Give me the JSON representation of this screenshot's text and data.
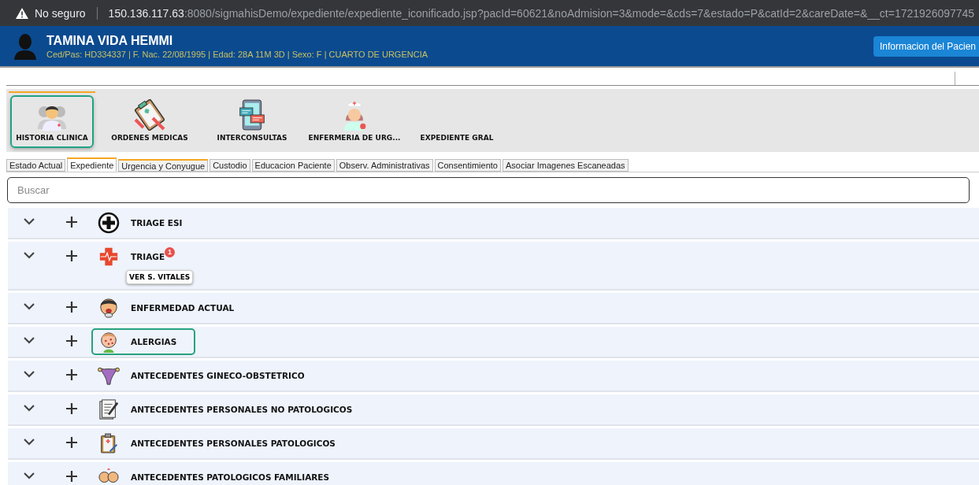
{
  "browser": {
    "security": "No seguro",
    "url_host": "150.136.117.63",
    "url_rest": ":8080/sigmahisDemo/expediente/expediente_iconificado.jsp?pacId=60621&noAdmision=3&mode=&cds=7&estado=P&catId=2&careDate=&__ct=1721926097745"
  },
  "patient": {
    "name": "TAMINA VIDA HEMMI",
    "details": "Ced/Pas: HD334337 | F. Nac. 22/08/1995 | Edad: 28A 11M 3D | Sexo: F  | CUARTO DE URGENCIA",
    "info_button": "Informacion del Pacien"
  },
  "modules": [
    {
      "label": "HISTORIA CLINICA",
      "kind": "doctor",
      "selected": true
    },
    {
      "label": "ORDENES MEDICAS",
      "kind": "clipboard",
      "selected": false
    },
    {
      "label": "INTERCONSULTAS",
      "kind": "chat",
      "selected": false
    },
    {
      "label": "ENFERMERIA DE URG...",
      "kind": "nurse",
      "selected": false
    },
    {
      "label": "EXPEDIENTE GRAL",
      "kind": "none",
      "selected": false
    }
  ],
  "tabs": [
    {
      "label": "Estado Actual",
      "selected": false,
      "flagged": false
    },
    {
      "label": "Expediente",
      "selected": true,
      "flagged": true
    },
    {
      "label": "Urgencia y Conyugue",
      "selected": false,
      "flagged": true
    },
    {
      "label": "Custodio",
      "selected": false,
      "flagged": false
    },
    {
      "label": "Educacion Paciente",
      "selected": false,
      "flagged": false
    },
    {
      "label": "Observ. Administrativas",
      "selected": false,
      "flagged": false
    },
    {
      "label": "Consentimiento",
      "selected": false,
      "flagged": false
    },
    {
      "label": "Asociar Imagenes Escaneadas",
      "selected": false,
      "flagged": false
    }
  ],
  "search": {
    "placeholder": "Buscar"
  },
  "sections": [
    {
      "title": "TRIAGE ESI",
      "kind": "circle-plus",
      "selected": false
    },
    {
      "title": "TRIAGE",
      "kind": "red-cross",
      "selected": false,
      "badge": "1",
      "button": "VER S. VITALES"
    },
    {
      "title": "ENFERMEDAD ACTUAL",
      "kind": "face",
      "selected": false
    },
    {
      "title": "ALERGIAS",
      "kind": "rash-face",
      "selected": true
    },
    {
      "title": "ANTECEDENTES GINECO-OBSTETRICO",
      "kind": "uterus",
      "selected": false
    },
    {
      "title": "ANTECEDENTES PERSONALES NO PATOLOGICOS",
      "kind": "notes",
      "selected": false
    },
    {
      "title": "ANTECEDENTES PERSONALES PATOLOGICOS",
      "kind": "clipboard",
      "selected": false
    },
    {
      "title": "ANTECEDENTES PATOLOGICOS FAMILIARES",
      "kind": "couple",
      "selected": false
    }
  ]
}
